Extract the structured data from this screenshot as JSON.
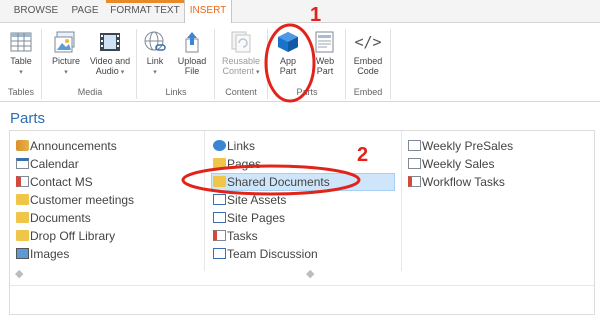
{
  "tabs": [
    "BROWSE",
    "PAGE",
    "FORMAT TEXT",
    "INSERT"
  ],
  "ribbon": {
    "table": {
      "label": "Table"
    },
    "picture": {
      "label": "Picture"
    },
    "video": {
      "label1": "Video and",
      "label2": "Audio"
    },
    "link": {
      "label": "Link"
    },
    "upload": {
      "label1": "Upload",
      "label2": "File"
    },
    "reusable": {
      "label1": "Reusable",
      "label2": "Content"
    },
    "apppart": {
      "label1": "App",
      "label2": "Part"
    },
    "webpart": {
      "label1": "Web",
      "label2": "Part"
    },
    "embed": {
      "label1": "Embed",
      "label2": "Code"
    },
    "groups": [
      "Tables",
      "Media",
      "Links",
      "Content",
      "Parts",
      "Embed"
    ]
  },
  "parts": {
    "title": "Parts",
    "columns": [
      [
        "Announcements",
        "Calendar",
        "Contact MS",
        "Customer meetings",
        "Documents",
        "Drop Off Library",
        "Images"
      ],
      [
        "Links",
        "Pages",
        "Shared Documents",
        "Site Assets",
        "Site Pages",
        "Tasks",
        "Team Discussion"
      ],
      [
        "Weekly PreSales",
        "Weekly Sales",
        "Workflow Tasks"
      ]
    ],
    "selected": "Shared Documents"
  },
  "annotations": [
    "1",
    "2"
  ],
  "colors": {
    "accent": "#e86a1a",
    "title_blue": "#2a6db3",
    "annotation_red": "#e2231a",
    "app_part_blue": "#1a73c9",
    "selection_bg": "#cfe6fa"
  }
}
